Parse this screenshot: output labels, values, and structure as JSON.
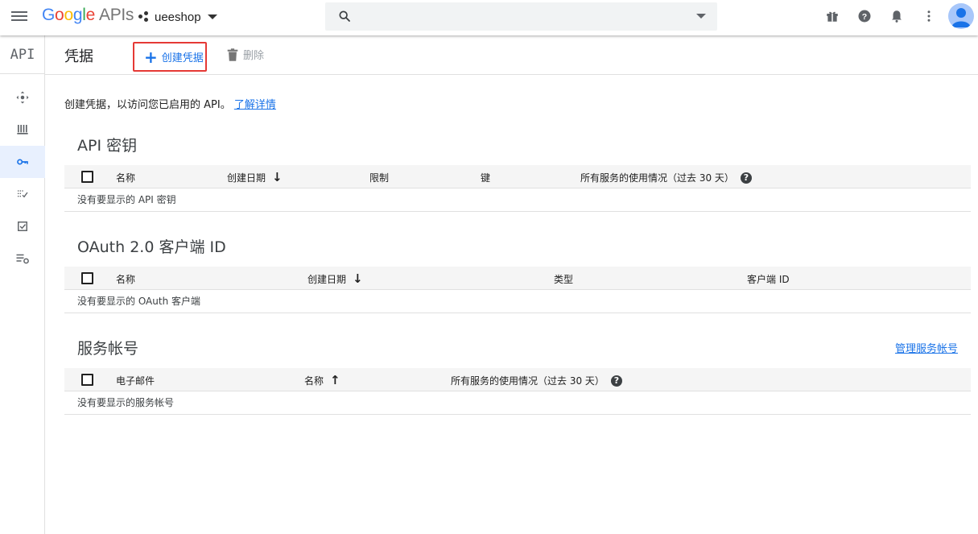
{
  "topbar": {
    "logo_google": [
      "G",
      "o",
      "o",
      "g",
      "l",
      "e"
    ],
    "logo_apis": "APIs",
    "project_name": "ueeshop",
    "search_placeholder": ""
  },
  "rail": {
    "api_label": "API"
  },
  "header": {
    "title": "凭据",
    "create_label": "创建凭据",
    "delete_label": "删除"
  },
  "intro": {
    "text": "创建凭据，以访问您已启用的 API。",
    "link": "了解详情"
  },
  "api_keys": {
    "title": "API 密钥",
    "columns": [
      "名称",
      "创建日期",
      "限制",
      "键",
      "所有服务的使用情况（过去 30 天）"
    ],
    "empty": "没有要显示的 API 密钥"
  },
  "oauth": {
    "title": "OAuth 2.0 客户端 ID",
    "columns": [
      "名称",
      "创建日期",
      "类型",
      "客户端 ID"
    ],
    "empty": "没有要显示的 OAuth 客户端"
  },
  "service_accounts": {
    "title": "服务帐号",
    "manage_link": "管理服务帐号",
    "columns": [
      "电子邮件",
      "名称",
      "所有服务的使用情况（过去 30 天）"
    ],
    "empty": "没有要显示的服务帐号"
  },
  "colors": {
    "accent": "#1a73e8",
    "highlight_border": "#e53935"
  }
}
